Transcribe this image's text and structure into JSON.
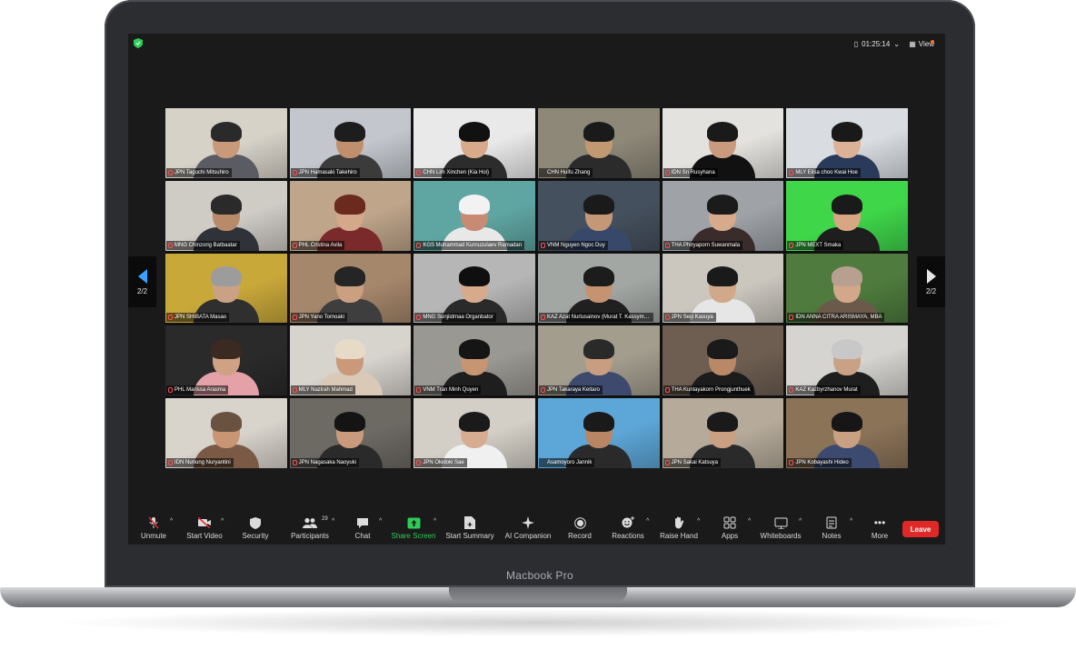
{
  "device": {
    "brand": "Macbook Pro"
  },
  "top_bar": {
    "timer": "01:25:14",
    "view_label": "View"
  },
  "gallery": {
    "page_left": "2/2",
    "page_right": "2/2",
    "participants": [
      {
        "name": "JPN Taguchi Mitsuhiro",
        "bg": "#d7d2c8",
        "skin": "#c99a7a",
        "hair": "#2a2a2a",
        "shirt": "#5b5c63",
        "muted": true
      },
      {
        "name": "JPN Hamasaki Takehiro",
        "bg": "#c3c7cd",
        "skin": "#c0906e",
        "hair": "#1d1d1d",
        "shirt": "#3b3b3b",
        "muted": true
      },
      {
        "name": "CHN Lim Xinchen (Kia Hoi)",
        "bg": "#e9e9e9",
        "skin": "#d8aa8a",
        "hair": "#111111",
        "shirt": "#2c2c2c",
        "muted": true
      },
      {
        "name": "CHN Huifu Zhang",
        "bg": "#8d8878",
        "skin": "#c29872",
        "hair": "#1a1a1a",
        "shirt": "#2b2b2b",
        "muted": false
      },
      {
        "name": "IDN Sri Rusyhana",
        "bg": "#e4e2de",
        "skin": "#c99a7e",
        "hair": "#1a1a1a",
        "shirt": "#111111",
        "muted": true
      },
      {
        "name": "MLY Elisa choo Kwai Hoe",
        "bg": "#d9dde2",
        "skin": "#dcb296",
        "hair": "#191919",
        "shirt": "#2a3a5a",
        "muted": true
      },
      {
        "name": "MNG Chinzorig Batbaatar",
        "bg": "#cfcbc5",
        "skin": "#b98a6a",
        "hair": "#2a2a2a",
        "shirt": "#2f3239",
        "muted": true
      },
      {
        "name": "PHL Cristina Avila",
        "bg": "#bfa58a",
        "skin": "#d4a88a",
        "hair": "#6b2a1e",
        "shirt": "#7a2a2a",
        "muted": true
      },
      {
        "name": "KGS Muhammad Kurnuzulaev Ramadan",
        "bg": "#5fa6a2",
        "skin": "#c88a72",
        "hair": "#f2f2f2",
        "shirt": "#e8e8e8",
        "muted": true
      },
      {
        "name": "VNM Nguyen Ngoc Duy",
        "bg": "#45505e",
        "skin": "#c49877",
        "hair": "#1a1a1a",
        "shirt": "#38486a",
        "muted": true
      },
      {
        "name": "THA Phiryaporn Suwanmala",
        "bg": "#9fa3a7",
        "skin": "#d7aa8c",
        "hair": "#1b1b1b",
        "shirt": "#3a2c2a",
        "muted": true
      },
      {
        "name": "JPN MEXT Smaka",
        "bg": "#3fd64a",
        "skin": "#d6a782",
        "hair": "#1a1a1a",
        "shirt": "#1e1e1e",
        "muted": true
      },
      {
        "name": "JPN SHIBATA Masao",
        "bg": "#c9a83a",
        "skin": "#caa184",
        "hair": "#9c9c9c",
        "shirt": "#2f2f2f",
        "muted": true
      },
      {
        "name": "JPN Yano Tomoaki",
        "bg": "#a5876b",
        "skin": "#caa081",
        "hair": "#252525",
        "shirt": "#3e3e3e",
        "muted": true
      },
      {
        "name": "MNG Sunjiidmaa Organbator",
        "bg": "#b6b6b6",
        "skin": "#d8aa8c",
        "hair": "#0f0f0f",
        "shirt": "#2a2a2a",
        "muted": true
      },
      {
        "name": "KAZ Azat Nurlusainov (Murat T. Kassymbay)",
        "bg": "#a3a7a4",
        "skin": "#c69372",
        "hair": "#1c1c1c",
        "shirt": "#202020",
        "muted": true
      },
      {
        "name": "JPN Seiji Kasuya",
        "bg": "#cbc7bf",
        "skin": "#d2a88a",
        "hair": "#1a1a1a",
        "shirt": "#e6e6e6",
        "muted": true
      },
      {
        "name": "IDN ANNA CITRA ARISMAYA, MBA",
        "bg": "#4f7b3e",
        "skin": "#d3a88a",
        "hair": "#b8a090",
        "shirt": "#6b5a4a",
        "muted": true
      },
      {
        "name": "PHL Marissa Arasma",
        "bg": "#2a2a2a",
        "skin": "#d0a285",
        "hair": "#3a2a22",
        "shirt": "#e4a2a8",
        "muted": true
      },
      {
        "name": "MLY Nazirah Mahmad",
        "bg": "#d7d3cd",
        "skin": "#c9997a",
        "hair": "#e7dbc8",
        "shirt": "#d9c9b6",
        "muted": true
      },
      {
        "name": "VNM Tran Minh Quyen",
        "bg": "#9a9892",
        "skin": "#c69572",
        "hair": "#151515",
        "shirt": "#1e1e1e",
        "muted": true
      },
      {
        "name": "JPN Takaraya Keitaro",
        "bg": "#a39d8e",
        "skin": "#c99e80",
        "hair": "#2a2a2a",
        "shirt": "#3d4a6e",
        "muted": true
      },
      {
        "name": "THA Kunlayakorn Prongjunthuek",
        "bg": "#6e5e52",
        "skin": "#b98866",
        "hair": "#1a1a1a",
        "shirt": "#1c1c1c",
        "muted": true
      },
      {
        "name": "KAZ Kazbyrzhanov Murat",
        "bg": "#d6d4d0",
        "skin": "#c9a285",
        "hair": "#c8c8c8",
        "shirt": "#1e1e1e",
        "muted": true
      },
      {
        "name": "IDN Nunung Nuryantini",
        "bg": "#d8d3cb",
        "skin": "#c89672",
        "hair": "#6a5240",
        "shirt": "#7a5a44",
        "muted": true
      },
      {
        "name": "JPN Nagasaka Naoyuki",
        "bg": "#6d6a64",
        "skin": "#c99b7c",
        "hair": "#141414",
        "shirt": "#2a2a2a",
        "muted": true
      },
      {
        "name": "JPN Okidoki Sae",
        "bg": "#d3cfc6",
        "skin": "#d6ad90",
        "hair": "#1a1a1a",
        "shirt": "#f0f0f0",
        "muted": true
      },
      {
        "name": "Asamoyoro Jannik",
        "bg": "#5da7d8",
        "skin": "#b88664",
        "hair": "#1a1a1a",
        "shirt": "#2a2a2a",
        "muted": false
      },
      {
        "name": "JPN Sakai Katsuya",
        "bg": "#b6ab9b",
        "skin": "#caa083",
        "hair": "#1a1a1a",
        "shirt": "#2a2a2a",
        "muted": true
      },
      {
        "name": "JPN Kobayashi Hideo",
        "bg": "#8b7358",
        "skin": "#caa083",
        "hair": "#161616",
        "shirt": "#3b4a6e",
        "muted": true
      }
    ]
  },
  "toolbar": {
    "unmute": "Unmute",
    "start_video": "Start Video",
    "security": "Security",
    "participants": "Participants",
    "participants_count": "29",
    "chat": "Chat",
    "share_screen": "Share Screen",
    "start_summary": "Start Summary",
    "ai_companion": "AI Companion",
    "record": "Record",
    "reactions": "Reactions",
    "raise_hand": "Raise Hand",
    "apps": "Apps",
    "whiteboards": "Whiteboards",
    "notes": "Notes",
    "more": "More",
    "leave": "Leave"
  },
  "colors": {
    "leave": "#e02828",
    "share": "#2ecc58",
    "page_arrow": "#3aa0ff"
  }
}
